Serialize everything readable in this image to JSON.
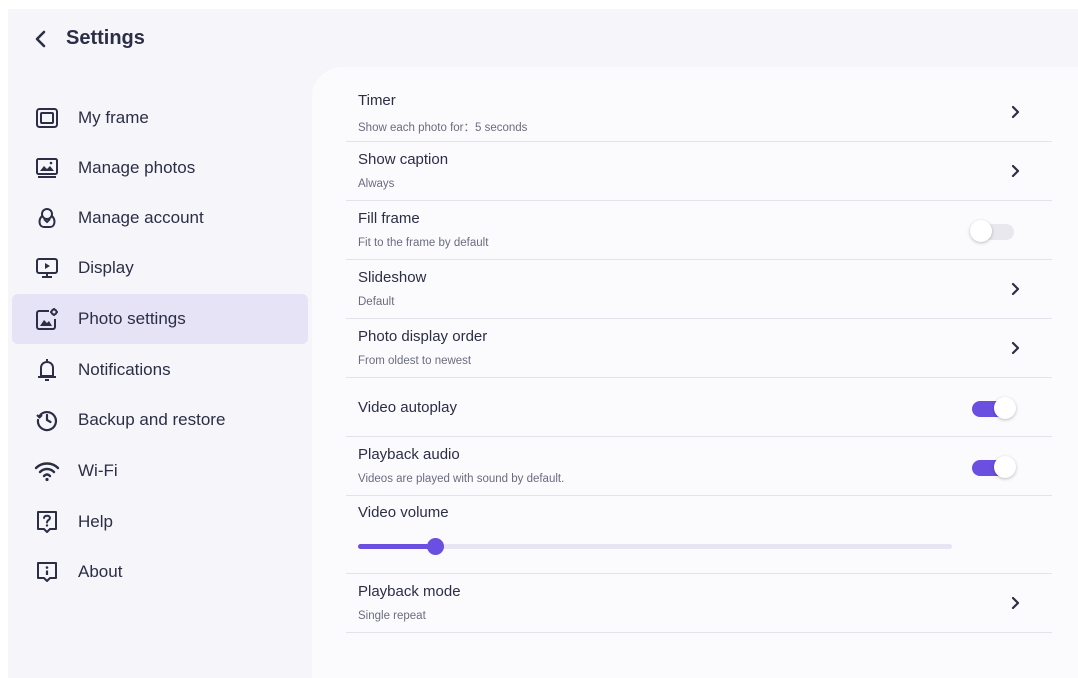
{
  "colors": {
    "accent": "#6b4fe0",
    "toggle_off_track": "#e8e8ee",
    "active_item_bg": "#e6e3f6"
  },
  "header": {
    "title": "Settings",
    "back_icon": "chevron-left-icon"
  },
  "sidebar": {
    "items": [
      {
        "label": "My frame",
        "icon": "frame-icon",
        "active": false
      },
      {
        "label": "Manage photos",
        "icon": "photos-icon",
        "active": false
      },
      {
        "label": "Manage account",
        "icon": "account-icon",
        "active": false
      },
      {
        "label": "Display",
        "icon": "display-icon",
        "active": false
      },
      {
        "label": "Photo settings",
        "icon": "photo-settings-icon",
        "active": true
      },
      {
        "label": "Notifications",
        "icon": "bell-icon",
        "active": false
      },
      {
        "label": "Backup and restore",
        "icon": "backup-restore-icon",
        "active": false
      },
      {
        "label": "Wi-Fi",
        "icon": "wifi-icon",
        "active": false
      },
      {
        "label": "Help",
        "icon": "help-icon",
        "active": false
      },
      {
        "label": "About",
        "icon": "info-icon",
        "active": false
      }
    ]
  },
  "settings": {
    "timer": {
      "title": "Timer",
      "subtitle": "Show each photo for：5 seconds"
    },
    "show_caption": {
      "title": "Show caption",
      "subtitle": "Always"
    },
    "fill_frame": {
      "title": "Fill frame",
      "subtitle": "Fit to the frame by default",
      "enabled": false
    },
    "slideshow": {
      "title": "Slideshow",
      "subtitle": "Default"
    },
    "photo_order": {
      "title": "Photo display order",
      "subtitle": "From oldest to newest"
    },
    "video_autoplay": {
      "title": "Video autoplay",
      "enabled": true
    },
    "playback_audio": {
      "title": "Playback audio",
      "subtitle": "Videos are played with sound by default.",
      "enabled": true
    },
    "video_volume": {
      "title": "Video volume",
      "level": 0.13
    },
    "playback_mode": {
      "title": "Playback mode",
      "subtitle": "Single repeat"
    }
  }
}
